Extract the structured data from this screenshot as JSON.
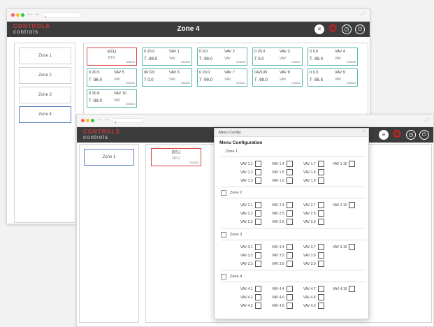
{
  "bg_window": {
    "title": "Zone 4",
    "logo_top": "CONTROLS",
    "logo_bottom": "controls",
    "zones": [
      "Zone 1",
      "Zone 2",
      "Zone 3",
      "Zone 4"
    ],
    "cards": [
      {
        "kind": "rtu",
        "name": "RTU",
        "sub": "RTU",
        "id": "153804"
      },
      {
        "kind": "vav",
        "setpoint": "0 20.0",
        "name": "VAV 1",
        "temp": "T -99.0",
        "sub": "VAV",
        "id": "153835"
      },
      {
        "kind": "vav",
        "setpoint": "0  0.0",
        "name": "VAV 2",
        "temp": "T -99.0",
        "sub": "VAV",
        "id": "153836"
      },
      {
        "kind": "vav",
        "setpoint": "0 20.0",
        "name": "VAV 3",
        "temp": "T  0.0",
        "sub": "VAV",
        "id": "153837"
      },
      {
        "kind": "vav",
        "setpoint": "0  0.0",
        "name": "VAV 4",
        "temp": "T -99.0",
        "sub": "VAV",
        "id": "153838"
      },
      {
        "kind": "vav",
        "setpoint": "0 20.5",
        "name": "VAV 5",
        "temp": "T -96.0",
        "sub": "VAV",
        "id": "153839"
      },
      {
        "kind": "vav",
        "setpoint": "06720",
        "name": "VAV 6",
        "temp": "T  0.0",
        "sub": "VAV",
        "id": "153840"
      },
      {
        "kind": "vav",
        "setpoint": "0 20.0",
        "name": "VAV 7",
        "temp": "T -99.0",
        "sub": "VAV",
        "id": "153841"
      },
      {
        "kind": "vav",
        "setpoint": "042100",
        "name": "VAV 8",
        "temp": "T -99.0",
        "sub": "VAV",
        "id": "153842"
      },
      {
        "kind": "vav",
        "setpoint": "0  0.3",
        "name": "VAV 9",
        "temp": "T -95.5",
        "sub": "VAV",
        "id": "153843"
      },
      {
        "kind": "vav",
        "setpoint": "0 20.8",
        "name": "VAV 10",
        "temp": "T -99.0",
        "sub": "VAV",
        "id": "153844"
      }
    ]
  },
  "fg_window": {
    "logo_top": "CONTROLS",
    "logo_bottom": "controls",
    "zones": [
      "Zone 1"
    ],
    "rtu": {
      "name": "RTU",
      "sub": "RTU",
      "id": "153801"
    }
  },
  "dialog": {
    "header": "Menu Config",
    "close": "×",
    "title": "Menu Configuration",
    "groups": [
      {
        "label": "Zone 1",
        "has_checkbox": false,
        "cols": [
          [
            "VAV 1.1",
            "VAV 1.2",
            "VAV 1.3"
          ],
          [
            "VAV 1.4",
            "VAV 1.5",
            "VAV 1.6"
          ],
          [
            "VAV 1.7",
            "VAV 1.8",
            "VAV 1.9"
          ],
          [
            "VAV 1.10"
          ]
        ]
      },
      {
        "label": "Zone 2",
        "has_checkbox": true,
        "cols": [
          [
            "VAV 2.1",
            "VAV 2.2",
            "VAV 2.3"
          ],
          [
            "VAV 2.4",
            "VAV 2.5",
            "VAV 2.6"
          ],
          [
            "VAV 2.7",
            "VAV 2.8",
            "VAV 2.9"
          ],
          [
            "VAV 2.10"
          ]
        ]
      },
      {
        "label": "Zone 3",
        "has_checkbox": true,
        "cols": [
          [
            "VAV 3.1",
            "VAV 3.2",
            "VAV 3.3"
          ],
          [
            "VAV 3.4",
            "VAV 3.5",
            "VAV 3.6"
          ],
          [
            "VAV 3.7",
            "VAV 3.8",
            "VAV 3.9"
          ],
          [
            "VAV 3.10"
          ]
        ]
      },
      {
        "label": "Zone 4",
        "has_checkbox": true,
        "cols": [
          [
            "VAV 4.1",
            "VAV 4.2",
            "VAV 4.3"
          ],
          [
            "VAV 4.4",
            "VAV 4.5",
            "VAV 4.6"
          ],
          [
            "VAV 4.7",
            "VAV 4.8",
            "VAV 4.9"
          ],
          [
            "VAV 4.10"
          ]
        ]
      }
    ]
  },
  "icons": {
    "menu": "menu-icon",
    "settings": "gear-icon",
    "clock": "clock-icon",
    "power": "power-icon"
  },
  "colors": {
    "accent": "#d92a2a",
    "appbar": "#3c3c3c",
    "card_border": "#5ab9b0",
    "rtu_border": "#dd4444"
  }
}
